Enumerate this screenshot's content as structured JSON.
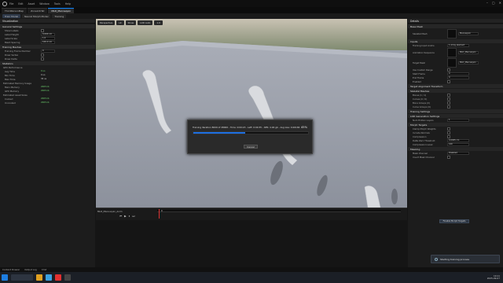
{
  "menu": [
    "File",
    "Edit",
    "Asset",
    "Window",
    "Tools",
    "Help"
  ],
  "tabs": [
    {
      "label": "ThirdPersonMap",
      "active": false
    },
    {
      "label": "ZoneinfoTst",
      "active": false
    },
    {
      "label": "MLD_Mannequin",
      "active": true
    }
  ],
  "toolbar": {
    "buttons": [
      "Train Model",
      "Neural Morph Model",
      "Training"
    ]
  },
  "left_panel": {
    "title": "Visualization",
    "sections": [
      {
        "title": "General Settings",
        "rows": [
          {
            "label": "Show Labels",
            "type": "check"
          },
          {
            "label": "Label Height",
            "type": "value",
            "value": "0.000 cm"
          },
          {
            "label": "Label Scale",
            "type": "value",
            "value": "1.0"
          },
          {
            "label": "Mesh Spacing",
            "type": "value",
            "value": "100.0 cm"
          }
        ]
      },
      {
        "title": "Training Meshes",
        "rows": [
          {
            "label": "Training Frame Number",
            "type": "value",
            "value": "0"
          },
          {
            "label": "Draw Vertex",
            "type": "check"
          },
          {
            "label": "Draw Delta",
            "type": "check"
          }
        ]
      },
      {
        "title": "Statistics",
        "rows": [
          {
            "label": "GPU Performance",
            "type": "header"
          },
          {
            "label": "Avg Time",
            "type": "green",
            "value": "0 us"
          },
          {
            "label": "Min Time",
            "type": "plain",
            "value": "0 us"
          },
          {
            "label": "Max Time",
            "type": "plain",
            "value": "35 us"
          },
          {
            "label": "Estimated Memory Usage",
            "type": "header"
          },
          {
            "label": "Main Memory",
            "type": "green",
            "value": "2065 kb"
          },
          {
            "label": "GPU Memory",
            "type": "green",
            "value": "2065 kb"
          },
          {
            "label": "Estimated Asset Sizes",
            "type": "header"
          },
          {
            "label": "Cooked",
            "type": "green",
            "value": "2065 kb"
          },
          {
            "label": "Uncooked",
            "type": "green",
            "value": "2065 kb"
          }
        ]
      }
    ]
  },
  "viewport": {
    "buttons": [
      "Perspective",
      "Lit",
      "Show",
      "LOD Auto",
      "1.0"
    ]
  },
  "dialog": {
    "message": "Training iteration 8000 of 28000 - Time: 0:00:23 - Left: 0:00:35 - RPS: 4.94 gb - Avg loss: 0.00184",
    "percent_label": "45%",
    "progress": 0.45,
    "cancel_label": "Cancel"
  },
  "timeline": {
    "track_label": "MLD_Mannequin_Anim",
    "frame": "0"
  },
  "right_panel": {
    "title": "Details",
    "sections": [
      {
        "title": "Base Mesh",
        "rows": [
          {
            "label": "Skeletal Mesh",
            "value": "Mannequin",
            "thumb": true
          }
        ]
      },
      {
        "title": "Inputs",
        "rows": [
          {
            "label": "Training Input Anims",
            "value": "1 Array element"
          },
          {
            "label": "Animation Sequence",
            "value": "MLD_Mannequin",
            "thumb": true
          },
          {
            "label": "Target Mesh",
            "value": "MLD_Mannequin",
            "thumb": true
          },
          {
            "label": "Use Custom Range",
            "value": ""
          },
          {
            "label": "Start Frame",
            "value": "0"
          },
          {
            "label": "End Frame",
            "value": "0"
          },
          {
            "label": "Enabled",
            "value": ""
          }
        ]
      },
      {
        "title": "Target Alignment Transform",
        "rows": []
      },
      {
        "title": "Skeletal Meshes",
        "rows": [
          {
            "label": "Bones (1 / 1)",
            "value": ""
          },
          {
            "label": "Curves (0 / 0)",
            "value": ""
          },
          {
            "label": "Bone Groups (0)",
            "value": ""
          },
          {
            "label": "Curve Groups (0)",
            "value": ""
          }
        ]
      },
      {
        "title": "Training Settings",
        "rows": []
      },
      {
        "title": "LOD Generation Settings",
        "rows": [
          {
            "label": "Num Hidden Layers",
            "value": "1"
          }
        ]
      },
      {
        "title": "Morph Targets",
        "rows": [
          {
            "label": "Clamp Morph Weights",
            "value": ""
          },
          {
            "label": "Include Normals",
            "value": ""
          },
          {
            "label": "Compression",
            "value": ""
          },
          {
            "label": "Delta Zero Threshold",
            "value": "0.0005 cm"
          },
          {
            "label": "Compression Level",
            "value": "100"
          }
        ]
      },
      {
        "title": "Masking",
        "rows": [
          {
            "label": "Mask Channel",
            "value": "Disabled"
          },
          {
            "label": "Invert Mask Channel",
            "value": ""
          }
        ]
      }
    ],
    "finalize_button": "Finalize Morph Targets"
  },
  "toast": {
    "text": "Starting training process"
  },
  "status": [
    "Content Drawer",
    "Output Log",
    "Cmd"
  ],
  "clock": {
    "time": "10:11",
    "date": "2025-09-07"
  }
}
